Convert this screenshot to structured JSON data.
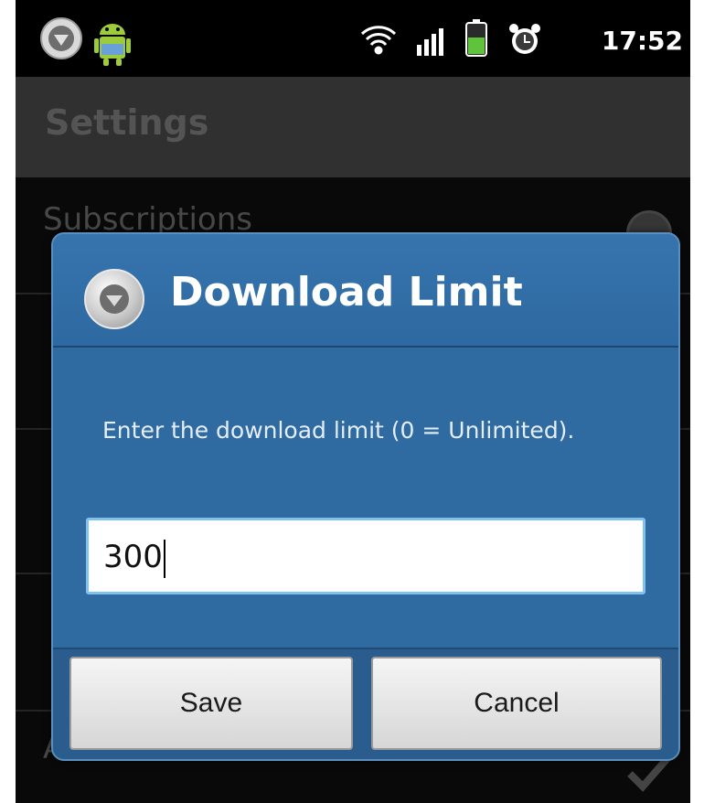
{
  "status_bar": {
    "time": "17:52",
    "icons": [
      "app-notification-icon",
      "android-robot-icon",
      "wifi-icon",
      "signal-icon",
      "battery-icon",
      "alarm-icon"
    ]
  },
  "settings": {
    "title": "Settings",
    "items": [
      {
        "label": "Subscriptions"
      },
      {
        "label": "Auto-start"
      }
    ]
  },
  "dialog": {
    "title": "Download Limit",
    "message": "Enter the download limit (0 = Unlimited).",
    "input_value": "300",
    "buttons": {
      "save": "Save",
      "cancel": "Cancel"
    }
  },
  "colors": {
    "dialog_blue": "#2f6aa0",
    "input_border": "#7fc2ef",
    "battery_green": "#5fc43b"
  }
}
